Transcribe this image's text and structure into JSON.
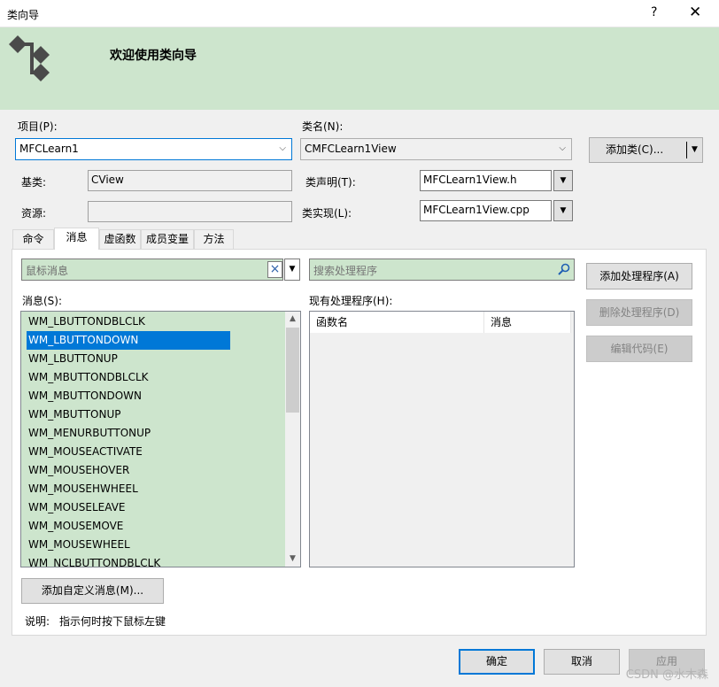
{
  "window": {
    "title": "类向导",
    "help": "?",
    "close": "✕"
  },
  "banner": {
    "heading": "欢迎使用类向导",
    "icon": "class-wizard-icon"
  },
  "project": {
    "label": "项目(P):",
    "value": "MFCLearn1"
  },
  "classname": {
    "label": "类名(N):",
    "value": "CMFCLearn1View"
  },
  "add_class_button": "添加类(C)...",
  "base_class": {
    "label": "基类:",
    "value": "CView"
  },
  "class_decl": {
    "label": "类声明(T):",
    "value": "MFCLearn1View.h"
  },
  "resource": {
    "label": "资源:",
    "value": ""
  },
  "class_impl": {
    "label": "类实现(L):",
    "value": "MFCLearn1View.cpp"
  },
  "tabs": [
    "命令",
    "消息",
    "虚函数",
    "成员变量",
    "方法"
  ],
  "active_tab": "消息",
  "message_filter": {
    "value": "鼠标消息",
    "clear": "×"
  },
  "handler_search": {
    "placeholder": "搜索处理程序"
  },
  "messages_label": "消息(S):",
  "messages": [
    "WM_LBUTTONDBLCLK",
    "WM_LBUTTONDOWN",
    "WM_LBUTTONUP",
    "WM_MBUTTONDBLCLK",
    "WM_MBUTTONDOWN",
    "WM_MBUTTONUP",
    "WM_MENURBUTTONUP",
    "WM_MOUSEACTIVATE",
    "WM_MOUSEHOVER",
    "WM_MOUSEHWHEEL",
    "WM_MOUSELEAVE",
    "WM_MOUSEMOVE",
    "WM_MOUSEWHEEL",
    "WM_NCLBUTTONDBLCLK"
  ],
  "selected_message": "WM_LBUTTONDOWN",
  "handlers_label": "现有处理程序(H):",
  "handler_columns": [
    "函数名",
    "消息"
  ],
  "add_handler_button": "添加处理程序(A)",
  "delete_handler_button": "删除处理程序(D)",
  "edit_code_button": "编辑代码(E)",
  "add_custom_message_button": "添加自定义消息(M)...",
  "description": {
    "label": "说明:",
    "text": "指示何时按下鼠标左键"
  },
  "footer": {
    "ok": "确定",
    "cancel": "取消",
    "apply": "应用"
  },
  "watermark": "CSDN @水木森",
  "colors": {
    "banner": "#cde5cd",
    "selection": "#0078d7",
    "list_bg": "#cde5cd"
  }
}
